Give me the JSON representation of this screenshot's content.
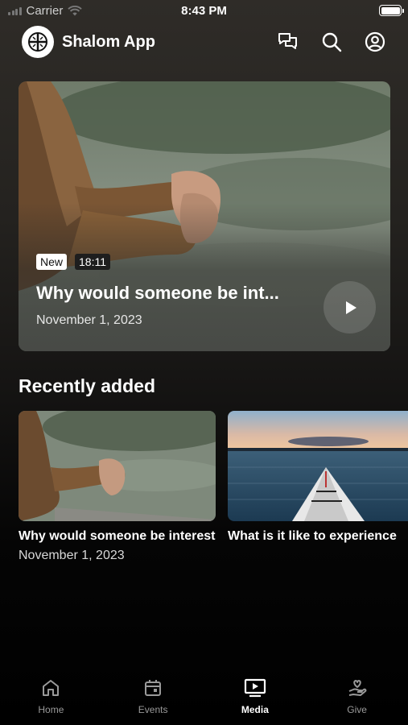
{
  "status_bar": {
    "carrier": "Carrier",
    "time": "8:43 PM"
  },
  "header": {
    "app_name": "Shalom App",
    "logo_icon": "cross-circle-logo",
    "icons": [
      "chat-icon",
      "search-icon",
      "profile-icon"
    ]
  },
  "hero": {
    "badge_new": "New",
    "duration": "18:11",
    "title": "Why would someone be int...",
    "date": "November 1, 2023"
  },
  "recently_added": {
    "title": "Recently added",
    "items": [
      {
        "title": "Why would someone be interested",
        "date": "November 1, 2023"
      },
      {
        "title": "What is it like to experience",
        "date": ""
      }
    ]
  },
  "tab_bar": {
    "active": "Media",
    "tabs": [
      {
        "label": "Home",
        "icon": "home-icon"
      },
      {
        "label": "Events",
        "icon": "calendar-icon"
      },
      {
        "label": "Media",
        "icon": "media-icon"
      },
      {
        "label": "Give",
        "icon": "give-icon"
      }
    ]
  },
  "colors": {
    "background": "#000000",
    "text": "#ffffff",
    "inactive_tab": "#9a9a9a"
  }
}
